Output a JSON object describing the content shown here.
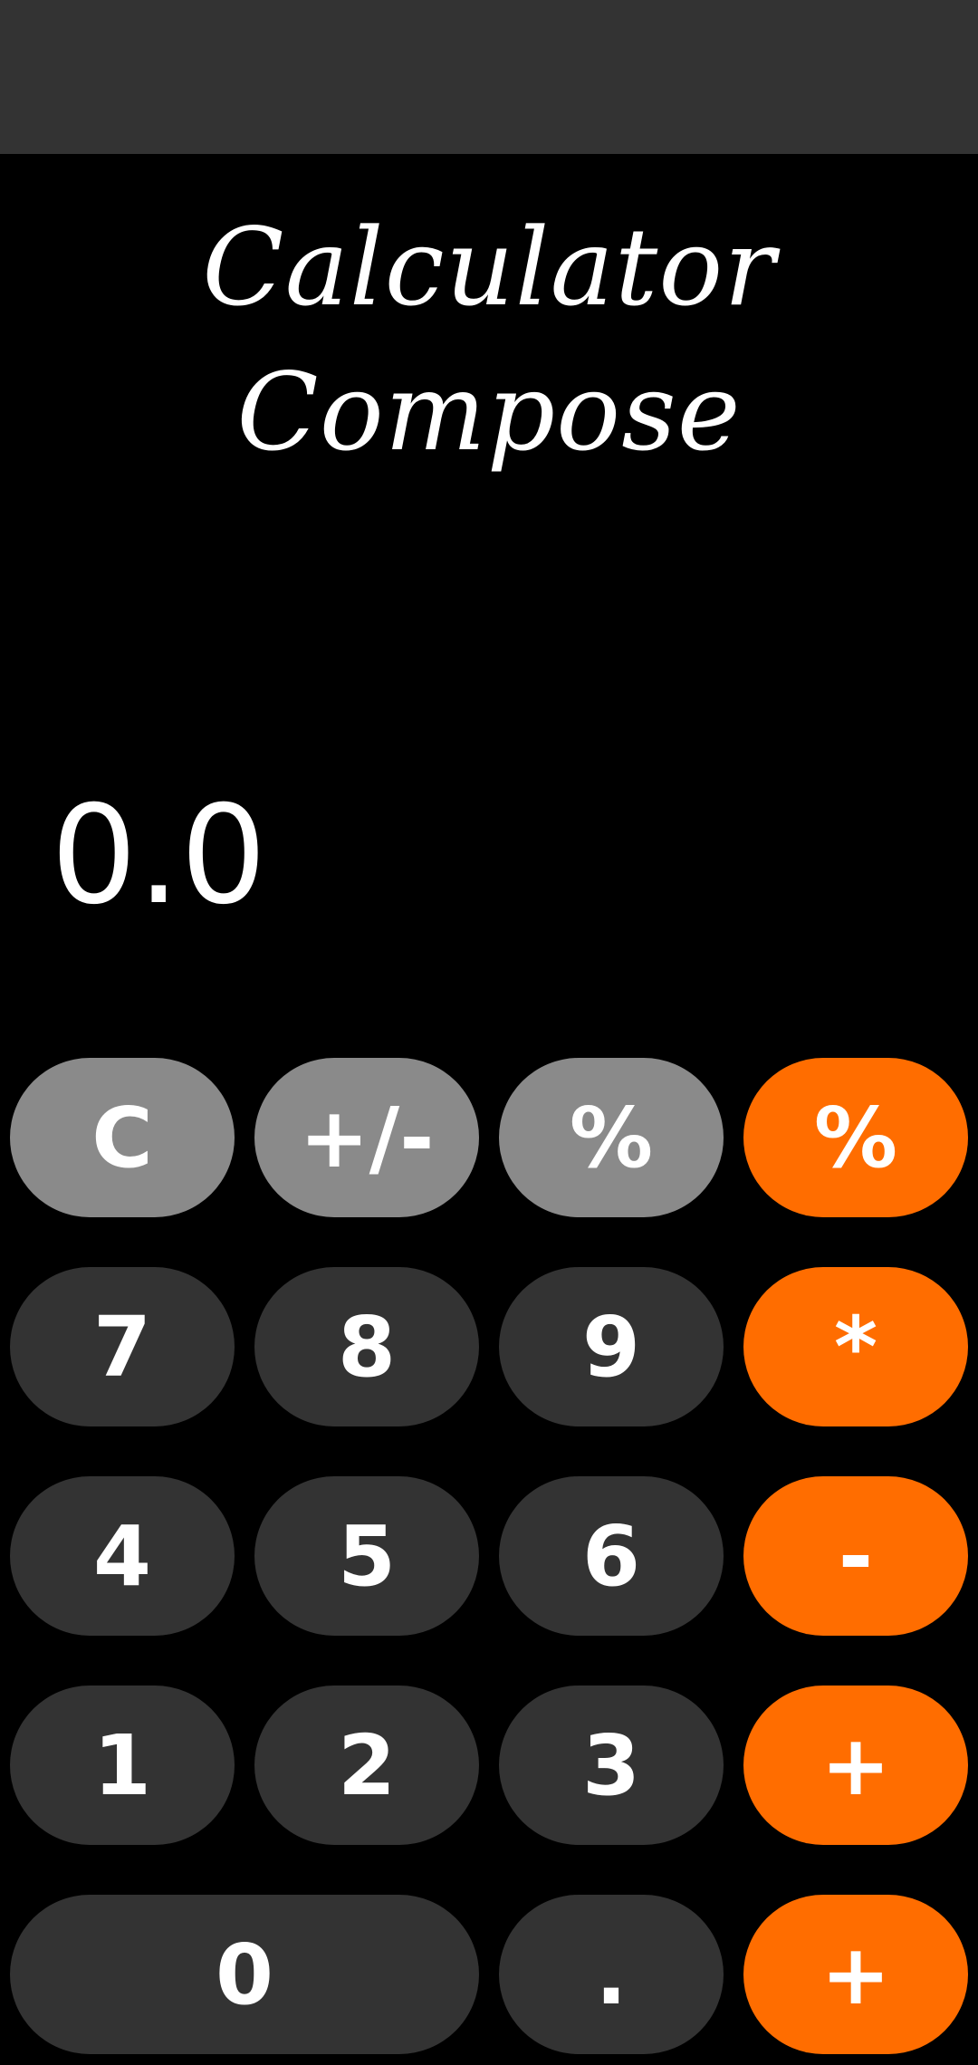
{
  "app": {
    "title": "Calculator Compose"
  },
  "display": {
    "value": "0.0"
  },
  "keypad": {
    "row1": [
      "C",
      "+/-",
      "%",
      "%"
    ],
    "row2": [
      "7",
      "8",
      "9",
      "*"
    ],
    "row3": [
      "4",
      "5",
      "6",
      "-"
    ],
    "row4": [
      "1",
      "2",
      "3",
      "+"
    ],
    "row5": [
      "0",
      ".",
      "+"
    ]
  },
  "colors": {
    "background": "#000000",
    "status_bar": "#333333",
    "function_key": "#8a8a8a",
    "number_key": "#333333",
    "operator_key": "#ff6d00",
    "text": "#ffffff"
  }
}
